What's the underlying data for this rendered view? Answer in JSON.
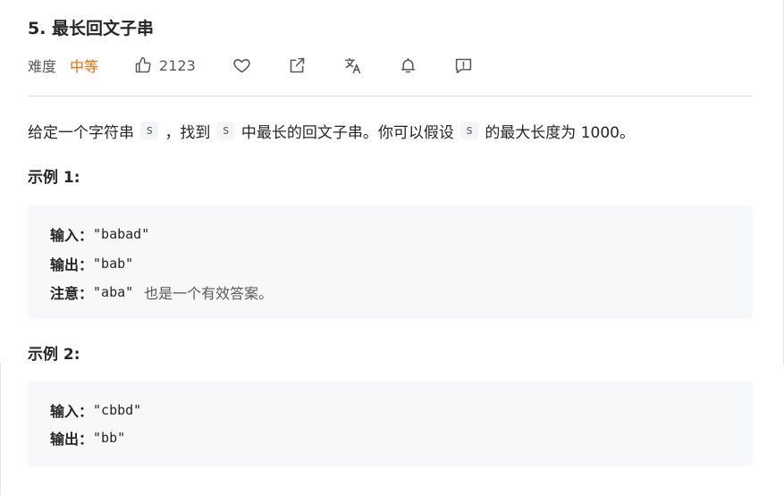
{
  "problem": {
    "title": "5. 最长回文子串",
    "difficulty_label": "难度",
    "difficulty": "中等",
    "likes": "2123"
  },
  "toolbar_icons": [
    "thumbs-up-icon",
    "heart-icon",
    "share-icon",
    "translate-icon",
    "bell-icon",
    "feedback-icon"
  ],
  "colors": {
    "difficulty_medium": "#ef6c00",
    "code_bg": "#f7f8fa"
  },
  "description": {
    "part1": "给定一个字符串",
    "var1": "s",
    "part2": "，找到",
    "var2": "s",
    "part3": "中最长的回文子串。你可以假设",
    "var3": "s",
    "part4": "的最大长度为 1000。"
  },
  "examples": [
    {
      "title": "示例 1:",
      "input_label": "输入：",
      "input": "\"babad\"",
      "output_label": "输出：",
      "output": "\"bab\"",
      "note_label": "注意：",
      "note_value": "\"aba\"",
      "note_text": "也是一个有效答案。"
    },
    {
      "title": "示例 2:",
      "input_label": "输入：",
      "input": "\"cbbd\"",
      "output_label": "输出：",
      "output": "\"bb\""
    }
  ]
}
